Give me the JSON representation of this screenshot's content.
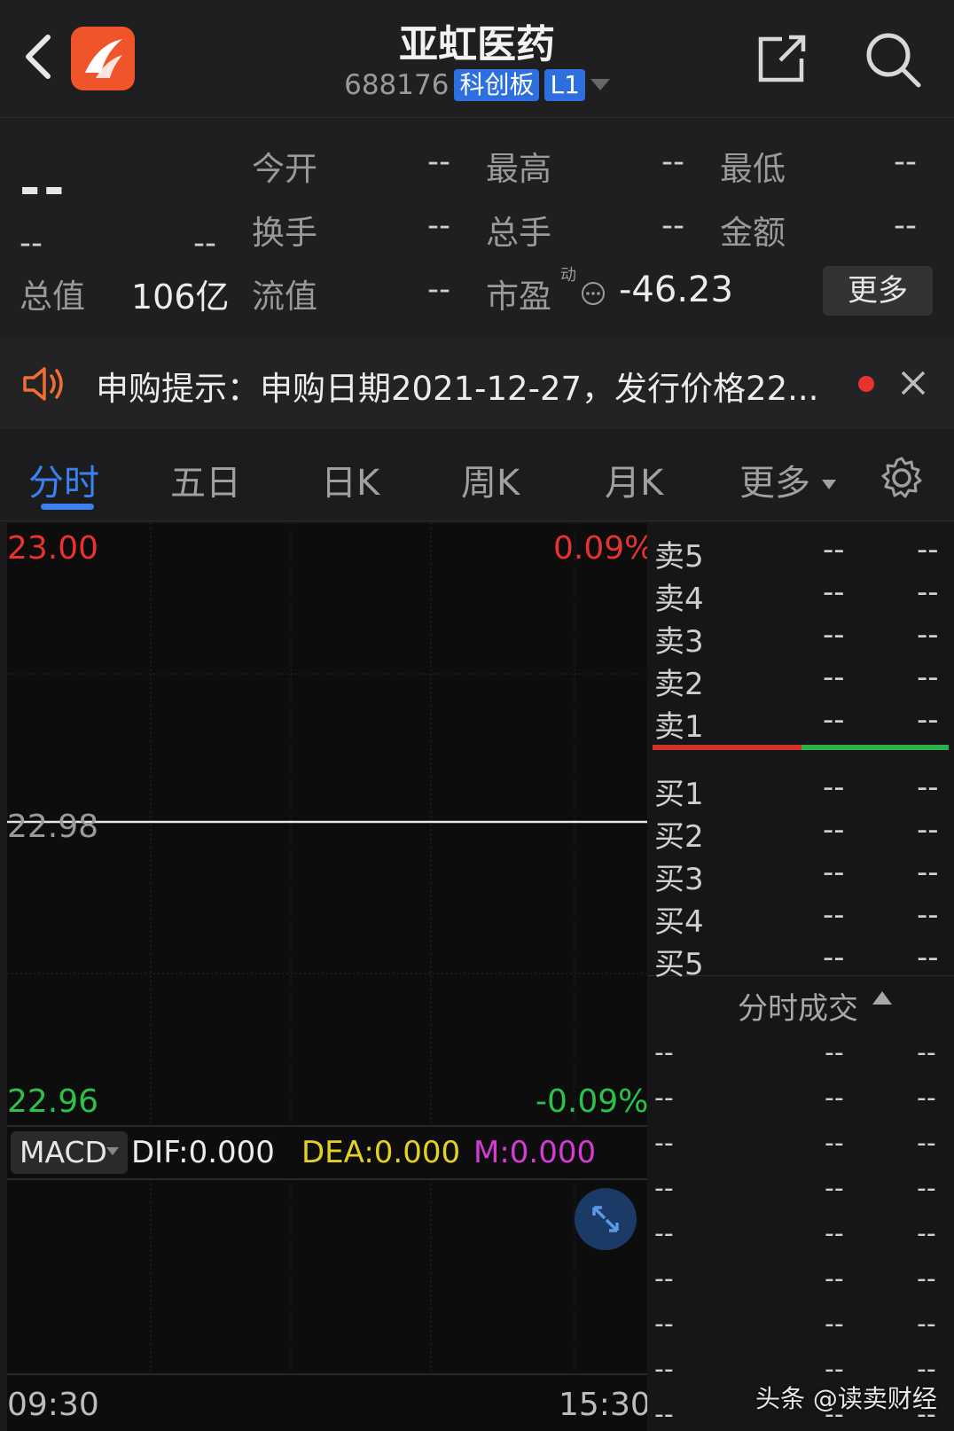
{
  "header": {
    "title": "亚虹医药",
    "code": "688176",
    "board_tag": "科创板",
    "level_tag": "L1",
    "icons": [
      "chevron-left-icon",
      "app-logo",
      "share-icon",
      "search-icon"
    ]
  },
  "quote": {
    "price": "--",
    "change": "--",
    "change_pct": "--",
    "rows": [
      [
        {
          "label": "今开",
          "value": "--"
        },
        {
          "label": "最高",
          "value": "--"
        },
        {
          "label": "最低",
          "value": "--"
        }
      ],
      [
        {
          "label": "换手",
          "value": "--"
        },
        {
          "label": "总手",
          "value": "--"
        },
        {
          "label": "金额",
          "value": "--"
        }
      ]
    ],
    "total_value_label": "总值",
    "total_value": "106亿",
    "float_value_label": "流值",
    "float_value": "--",
    "pe_label": "市盈",
    "pe_sup": "动",
    "pe_value": "-46.23",
    "more_label": "更多"
  },
  "notice": {
    "text": "申购提示：申购日期2021-12-27，发行价格22..."
  },
  "tabs": {
    "items": [
      "分时",
      "五日",
      "日K",
      "周K",
      "月K",
      "更多"
    ],
    "active": "分时"
  },
  "chart": {
    "price_high": "23.00",
    "price_mid": "22.98",
    "price_low": "22.96",
    "pct_high": "0.09%",
    "pct_low": "-0.09%",
    "macd_label": "MACD",
    "dif": "DIF:0.000",
    "dea": "DEA:0.000",
    "m": "M:0.000",
    "time_start": "09:30",
    "time_end": "15:30",
    "colors": {
      "up": "#e8322e",
      "down": "#2bc24a",
      "dea": "#e6d21e",
      "m": "#d63bd6"
    }
  },
  "orderbook": {
    "asks": [
      {
        "label": "卖5",
        "price": "--",
        "vol": "--"
      },
      {
        "label": "卖4",
        "price": "--",
        "vol": "--"
      },
      {
        "label": "卖3",
        "price": "--",
        "vol": "--"
      },
      {
        "label": "卖2",
        "price": "--",
        "vol": "--"
      },
      {
        "label": "卖1",
        "price": "--",
        "vol": "--"
      }
    ],
    "bids": [
      {
        "label": "买1",
        "price": "--",
        "vol": "--"
      },
      {
        "label": "买2",
        "price": "--",
        "vol": "--"
      },
      {
        "label": "买3",
        "price": "--",
        "vol": "--"
      },
      {
        "label": "买4",
        "price": "--",
        "vol": "--"
      },
      {
        "label": "买5",
        "price": "--",
        "vol": "--"
      }
    ],
    "trades_title": "分时成交",
    "trades": [
      [
        "--",
        "--",
        "--"
      ],
      [
        "--",
        "--",
        "--"
      ],
      [
        "--",
        "--",
        "--"
      ],
      [
        "--",
        "--",
        "--"
      ],
      [
        "--",
        "--",
        "--"
      ],
      [
        "--",
        "--",
        "--"
      ],
      [
        "--",
        "--",
        "--"
      ],
      [
        "--",
        "--",
        "--"
      ],
      [
        "--",
        "--",
        "--"
      ]
    ]
  },
  "watermark": "头条 @读卖财经"
}
